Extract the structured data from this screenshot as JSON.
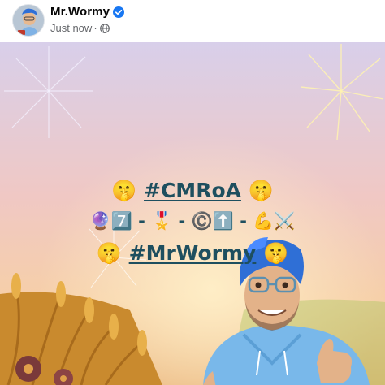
{
  "post": {
    "author": "Mr.Wormy",
    "timestamp": "Just now",
    "separator": "·",
    "verified_icon": "verified-badge-icon",
    "audience_icon": "globe-icon",
    "verified_color": "#1877f2"
  },
  "image": {
    "line1": {
      "left_emoji": "🤫",
      "hashtag": "#CMRoA",
      "right_emoji": "🤫"
    },
    "line2": "🔮7️⃣ - 🎖️ - ©️⬆️ - 💪⚔️",
    "line3": {
      "left_emoji": "🤫",
      "hashtag": "#MrWormy",
      "right_emoji": "🤫"
    }
  }
}
